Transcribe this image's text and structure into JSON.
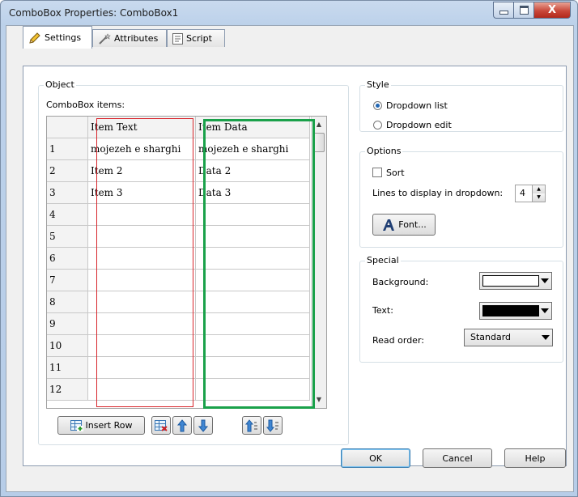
{
  "window": {
    "title": "ComboBox Properties: ComboBox1"
  },
  "caption_buttons": {
    "minimize": "–",
    "maximize": "▢",
    "close": "X"
  },
  "tabs": [
    {
      "label": "Settings",
      "icon": "pencil-icon",
      "active": true
    },
    {
      "label": "Attributes",
      "icon": "wand-icon",
      "active": false
    },
    {
      "label": "Script",
      "icon": "script-icon",
      "active": false
    }
  ],
  "object_group": {
    "label": "Object",
    "items_label": "ComboBox items:",
    "columns": [
      "Item Text",
      "Item Data"
    ],
    "rows": [
      {
        "num": "1",
        "text": "mojezeh e sharghi",
        "data": "mojezeh e sharghi"
      },
      {
        "num": "2",
        "text": "Item 2",
        "data": "Data 2"
      },
      {
        "num": "3",
        "text": "Item 3",
        "data": "Data 3"
      },
      {
        "num": "4",
        "text": "",
        "data": ""
      },
      {
        "num": "5",
        "text": "",
        "data": ""
      },
      {
        "num": "6",
        "text": "",
        "data": ""
      },
      {
        "num": "7",
        "text": "",
        "data": ""
      },
      {
        "num": "8",
        "text": "",
        "data": ""
      },
      {
        "num": "9",
        "text": "",
        "data": ""
      },
      {
        "num": "10",
        "text": "",
        "data": ""
      },
      {
        "num": "11",
        "text": "",
        "data": ""
      },
      {
        "num": "12",
        "text": "",
        "data": ""
      }
    ],
    "insert_row_label": "Insert Row"
  },
  "style_group": {
    "label": "Style",
    "options": [
      {
        "label": "Dropdown list",
        "selected": true
      },
      {
        "label": "Dropdown edit",
        "selected": false
      }
    ]
  },
  "options_group": {
    "label": "Options",
    "sort_label": "Sort",
    "sort_checked": false,
    "lines_label": "Lines to display in dropdown:",
    "lines_value": "4",
    "font_button": "Font..."
  },
  "special_group": {
    "label": "Special",
    "background_label": "Background:",
    "background_color": "#ffffff",
    "text_label": "Text:",
    "text_color": "#000000",
    "read_order_label": "Read order:",
    "read_order_value": "Standard"
  },
  "footer": {
    "ok": "OK",
    "cancel": "Cancel",
    "help": "Help"
  },
  "colors": {
    "highlight_red": "#d8262c",
    "highlight_green": "#1aa14a",
    "accent": "#2166b3"
  }
}
